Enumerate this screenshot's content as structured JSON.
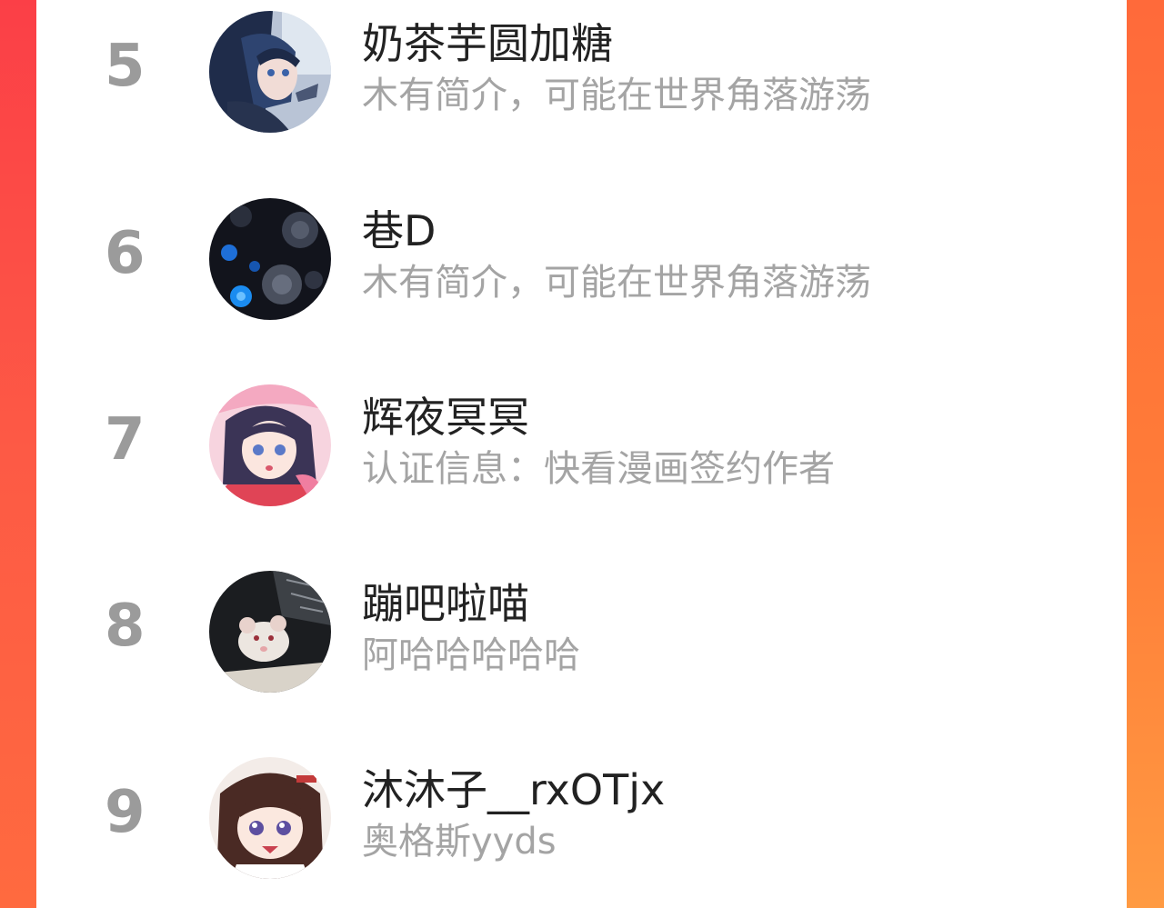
{
  "ranking": {
    "items": [
      {
        "rank": "5",
        "name": "奶茶芋圆加糖",
        "description": "木有简介，可能在世界角落游荡",
        "avatar_icon": "anime-girl-dark-blue-hair-avatar"
      },
      {
        "rank": "6",
        "name": "巷D",
        "description": "木有简介，可能在世界角落游荡",
        "avatar_icon": "dark-roses-avatar"
      },
      {
        "rank": "7",
        "name": "辉夜冥冥",
        "description": "认证信息：快看漫画签约作者",
        "avatar_icon": "anime-girl-pink-avatar"
      },
      {
        "rank": "8",
        "name": "蹦吧啦喵",
        "description": "阿哈哈哈哈哈",
        "avatar_icon": "white-rat-avatar"
      },
      {
        "rank": "9",
        "name": "沐沐子__rxOTjx",
        "description": "奥格斯yyds",
        "avatar_icon": "anime-chibi-girl-avatar"
      }
    ]
  },
  "colors": {
    "rank_text": "#9b9b9b",
    "name_text": "#222222",
    "desc_text": "#a4a4a4",
    "background_accent": "#ff6a3c",
    "card": "#ffffff"
  }
}
